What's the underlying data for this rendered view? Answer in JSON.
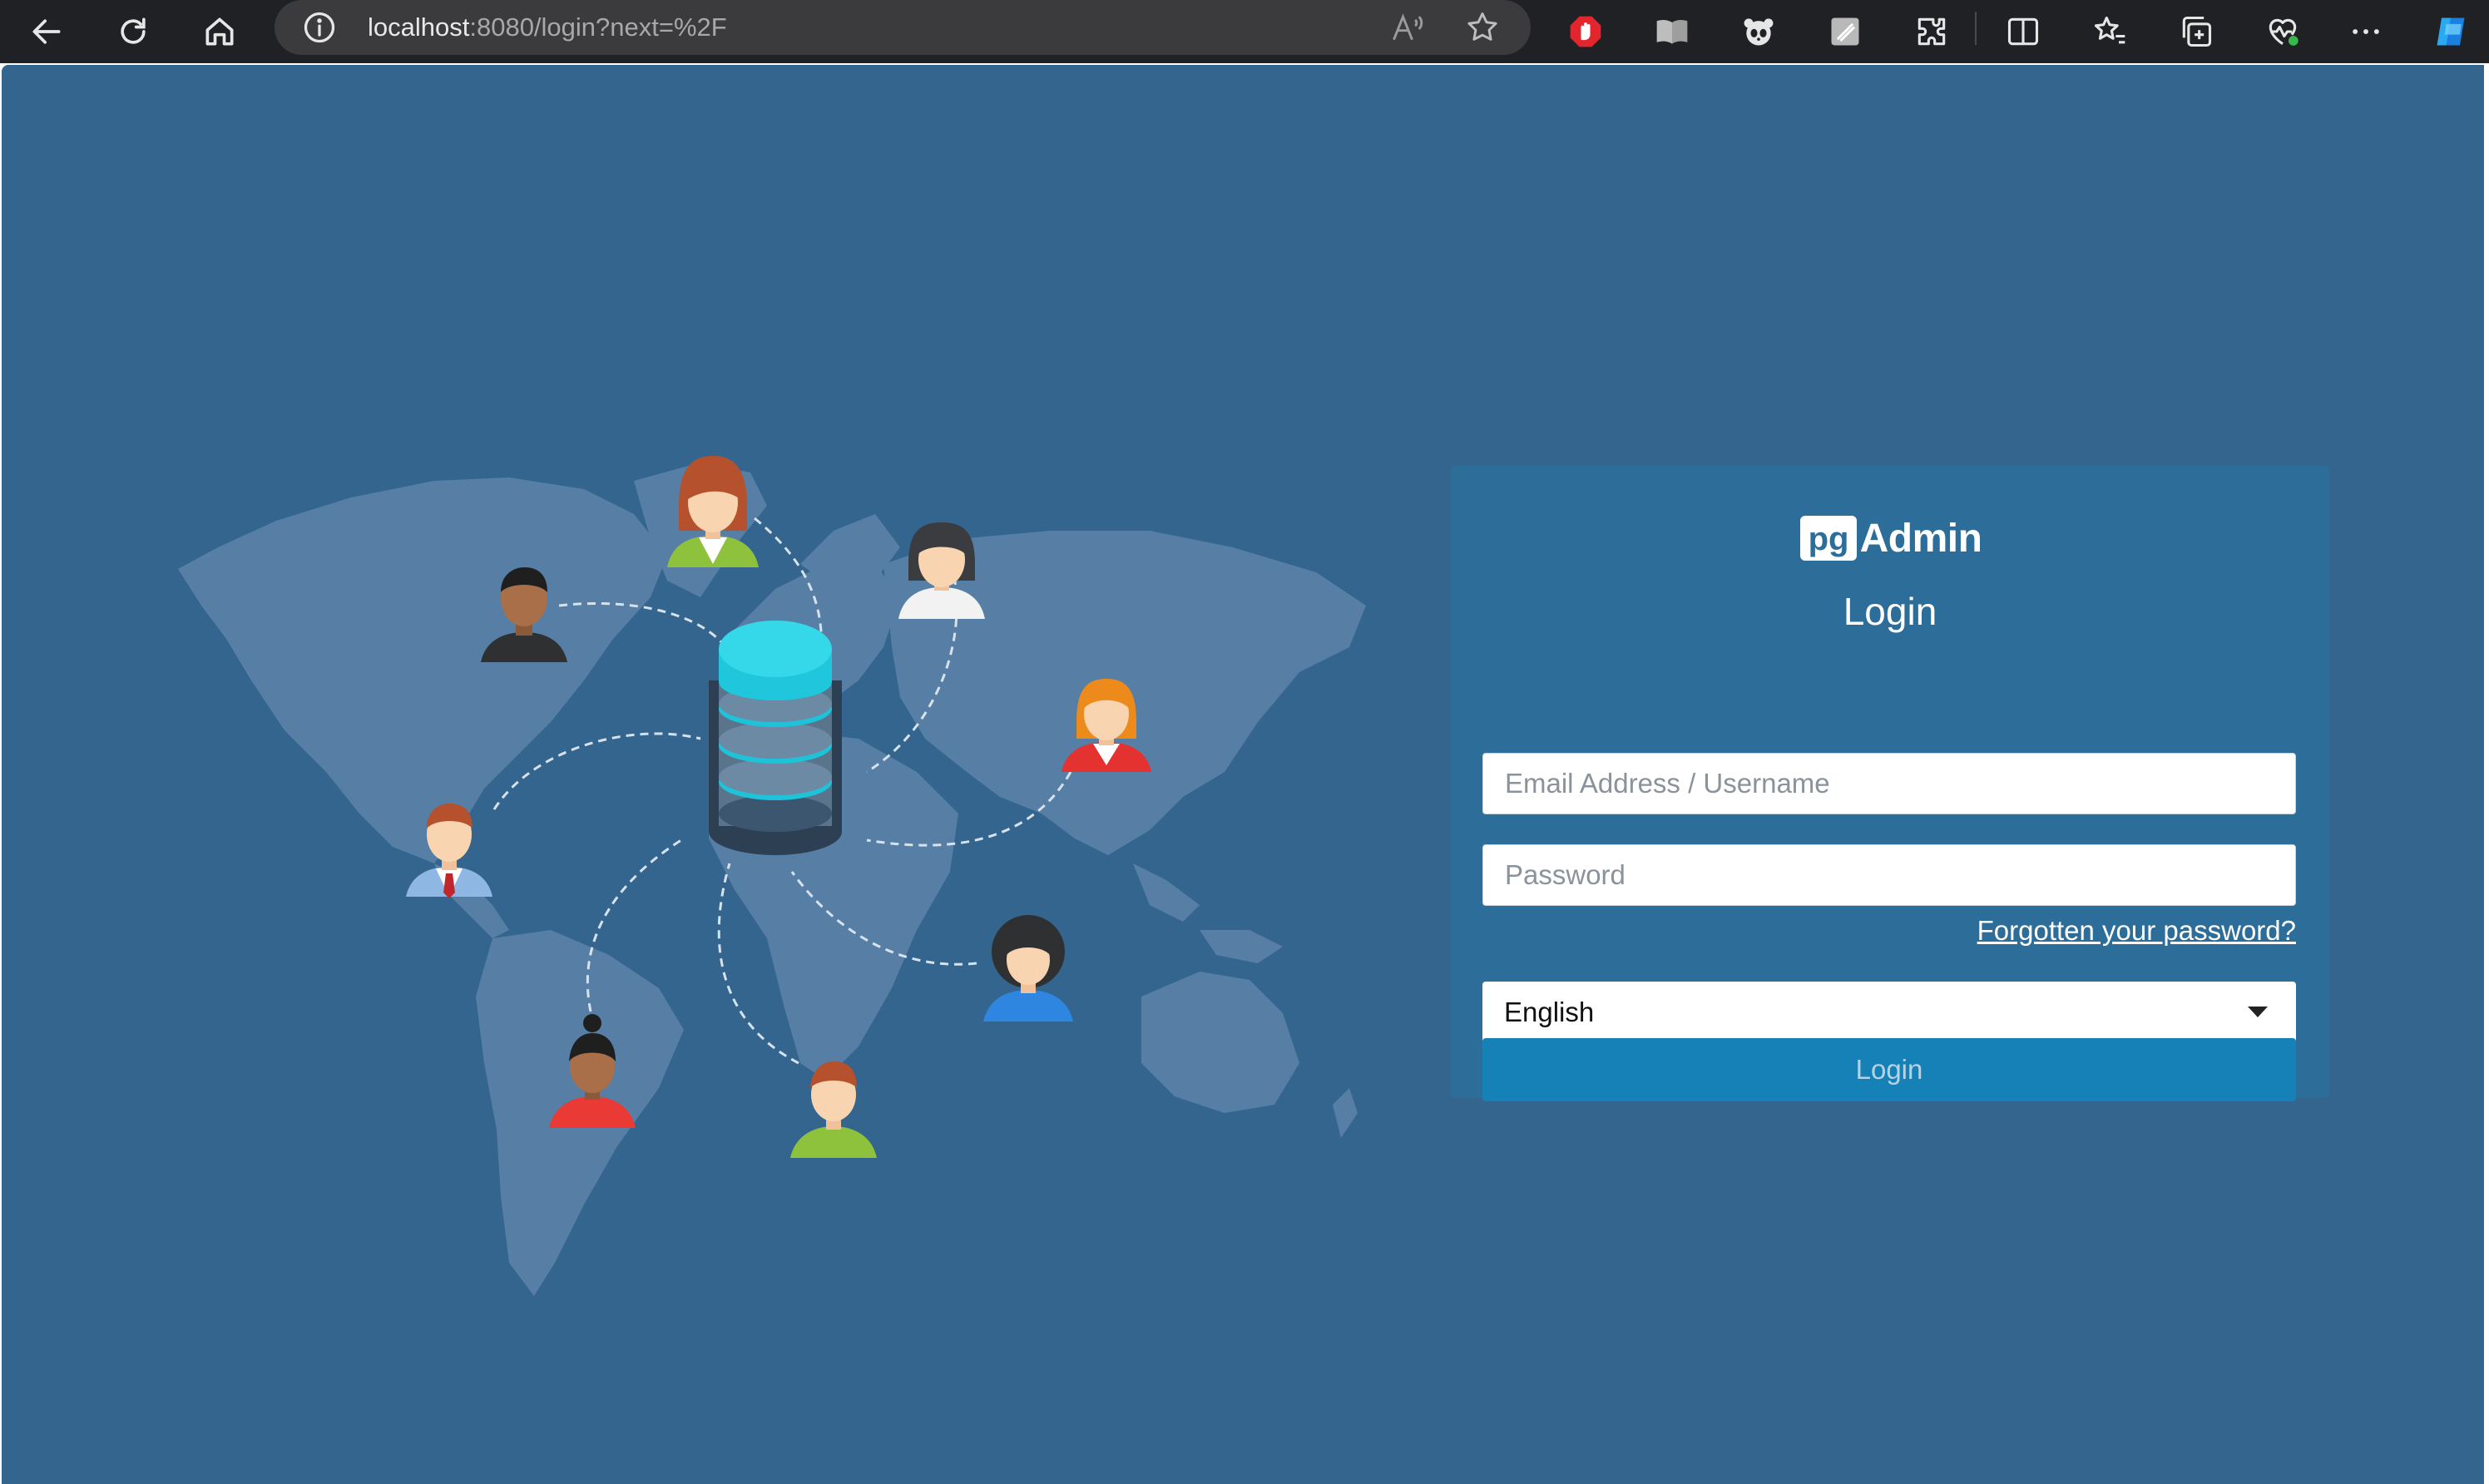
{
  "browser": {
    "url_host": "localhost",
    "url_rest": ":8080/login?next=%2F"
  },
  "login": {
    "brand_prefix": "pg",
    "brand_name": "Admin",
    "title": "Login",
    "email_placeholder": "Email Address / Username",
    "password_placeholder": "Password",
    "forgot_password": "Forgotten your password?",
    "language": "English",
    "submit_label": "Login"
  },
  "colors": {
    "page_background": "#33658f",
    "card_background": "#2c6d99",
    "login_button": "#1681b6",
    "browser_chrome": "#202124"
  },
  "icons": {
    "chrome": [
      "back-icon",
      "refresh-icon",
      "home-icon",
      "site-info-icon",
      "read-aloud-icon",
      "favorite-star-icon",
      "adblock-icon",
      "reading-view-icon",
      "panda-extension-icon",
      "note-extension-icon",
      "extensions-icon",
      "split-screen-icon",
      "favorites-icon",
      "collections-icon",
      "browser-essentials-icon",
      "more-icon",
      "copilot-icon"
    ]
  }
}
